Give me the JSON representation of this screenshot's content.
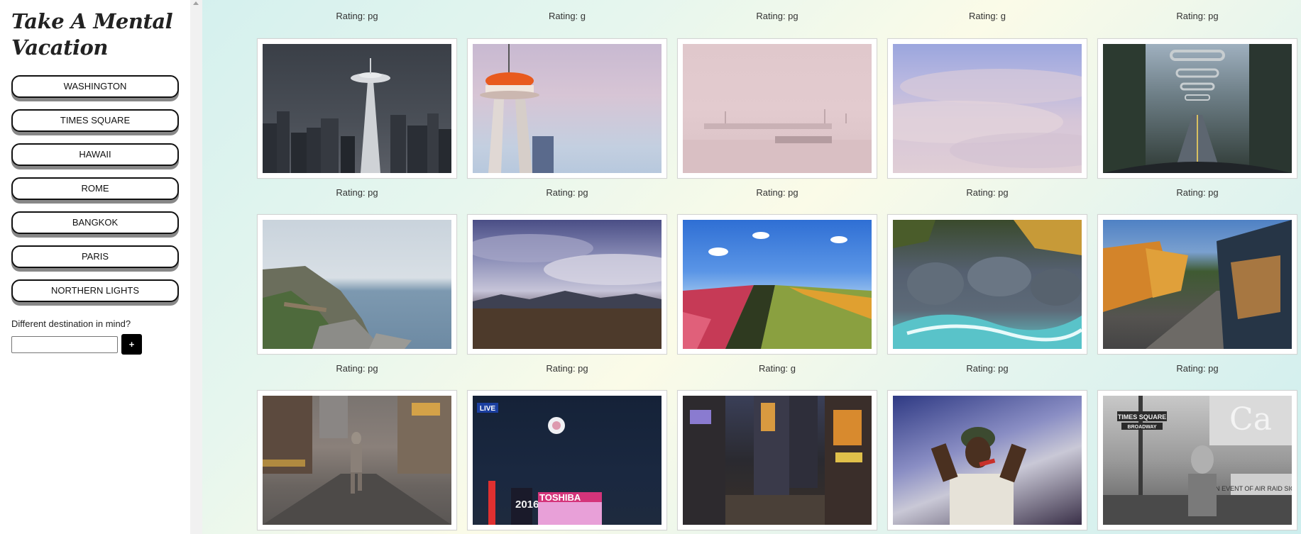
{
  "sidebar": {
    "title": "Take A Mental Vacation",
    "destinations": [
      "Washington",
      "Times Square",
      "Hawaii",
      "Rome",
      "Bangkok",
      "Paris",
      "Northern Lights"
    ],
    "prompt": "Different destination in mind?",
    "input_value": "",
    "input_placeholder": "",
    "add_label": "+"
  },
  "grid": {
    "top_ratings": [
      "Rating: pg",
      "Rating: g",
      "Rating: pg",
      "Rating: g",
      "Rating: pg"
    ],
    "cards": [
      {
        "rating": "Rating: pg",
        "scene": "space-needle-storm-skyline"
      },
      {
        "rating": "Rating: pg",
        "scene": "space-needle-closeup-dusk"
      },
      {
        "rating": "Rating: pg",
        "scene": "foggy-harbor-pink"
      },
      {
        "rating": "Rating: pg",
        "scene": "clouds-lavender-sky"
      },
      {
        "rating": "Rating: pg",
        "scene": "bridge-drive-forest"
      },
      {
        "rating": "Rating: pg",
        "scene": "rocky-coast-sea"
      },
      {
        "rating": "Rating: pg",
        "scene": "cloudy-field-mountains"
      },
      {
        "rating": "Rating: g",
        "scene": "tulip-field"
      },
      {
        "rating": "Rating: pg",
        "scene": "river-rocks-autumn"
      },
      {
        "rating": "Rating: pg",
        "scene": "autumn-road-car"
      },
      {
        "rating": "",
        "scene": "times-square-street-runner"
      },
      {
        "rating": "",
        "scene": "times-square-new-year-ball"
      },
      {
        "rating": "",
        "scene": "times-square-crowd"
      },
      {
        "rating": "",
        "scene": "person-reacting"
      },
      {
        "rating": "",
        "scene": "times-square-vintage-bw"
      }
    ]
  },
  "texts": {
    "live_badge": "LIVE",
    "year_sign": "2016",
    "toshiba_sign": "TOSHIBA",
    "ts_sign": "TIMES SQUARE",
    "broadway_sign": "BROADWAY",
    "air_raid_sign": "IN EVENT OF AIR RAID SIGNAL"
  },
  "colors": {
    "nav_button_border": "#111111",
    "nav_button_shadow": "#888888",
    "add_button_bg": "#000000"
  }
}
